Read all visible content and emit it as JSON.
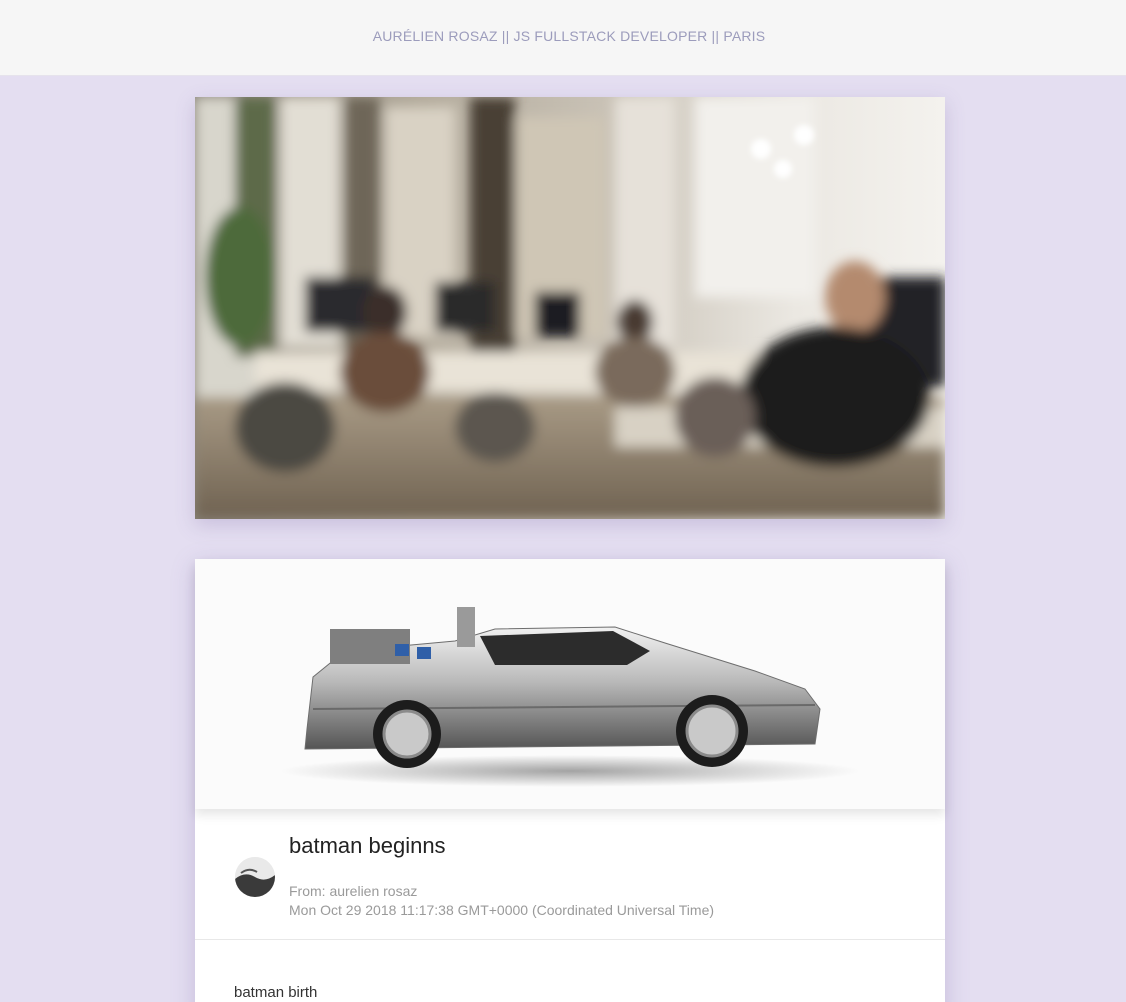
{
  "header": {
    "site_title": "AURÉLIEN ROSAZ || JS FULLSTACK DEVELOPER || PARIS"
  },
  "hero": {
    "image_subject": "office-photo"
  },
  "post": {
    "image_subject": "delorean-car",
    "title": "batman beginns",
    "from": "From: aurelien rosaz",
    "date": "Mon Oct 29 2018 11:17:38 GMT+0000 (Coordinated Universal Time)",
    "body": "batman birth"
  },
  "colors": {
    "page_background": "#e4def1",
    "header_background": "#f6f6f6",
    "header_text": "#9c9cbc",
    "meta_text": "#9a9a9a"
  }
}
